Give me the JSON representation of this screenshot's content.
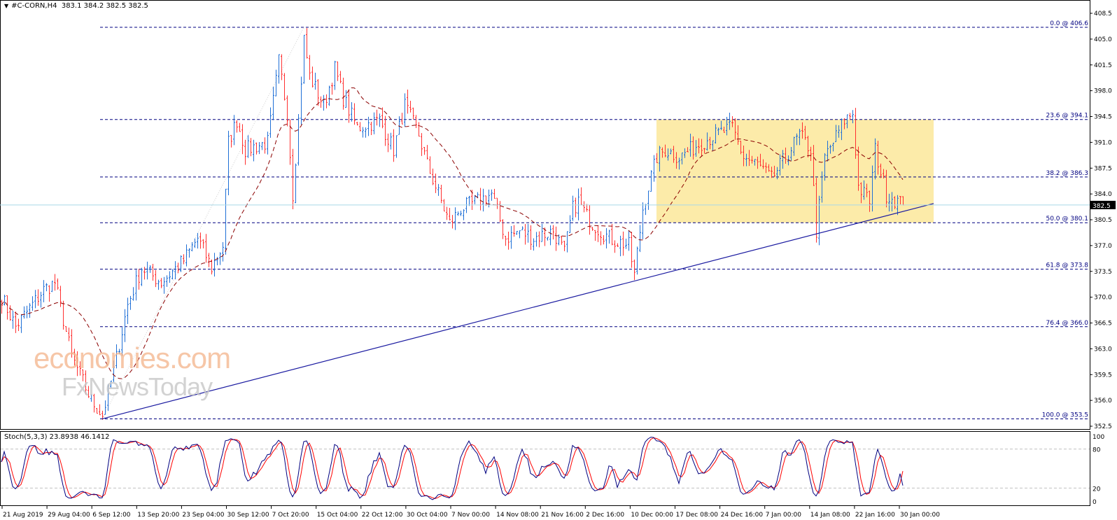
{
  "header": {
    "symbol": "#C-CORN,H4",
    "ohlc": "383.1 384.2 382.5 382.5"
  },
  "watermark": {
    "line1": "economies.com",
    "line2": "FxNewsToday"
  },
  "indicator": {
    "label": "Stoch(5,3,3) 23.8938 46.1412"
  },
  "colors": {
    "bull": "#1f6fd6",
    "bear": "#ff3030",
    "fib": "#000080",
    "trend": "#1a1aa0",
    "zone": "#fce89a",
    "ma": "#8b0000",
    "bid": "#a8d8e8",
    "stoch_main": "#000080",
    "stoch_signal": "#ff0000"
  },
  "chart_data": {
    "type": "ohlc",
    "title": "#C-CORN,H4",
    "ylim": [
      352.5,
      408.5
    ],
    "yticks": [
      "408.5",
      "405.0",
      "401.5",
      "398.0",
      "394.5",
      "391.0",
      "387.5",
      "384.0",
      "380.5",
      "377.0",
      "373.5",
      "370.0",
      "366.5",
      "363.0",
      "359.5",
      "356.0",
      "352.5"
    ],
    "current_price": "382.5",
    "xticks": [
      "21 Aug 2019",
      "29 Aug 04:00",
      "6 Sep 12:00",
      "13 Sep 20:00",
      "23 Sep 04:00",
      "30 Sep 12:00",
      "7 Oct 20:00",
      "15 Oct 04:00",
      "22 Oct 12:00",
      "30 Oct 04:00",
      "7 Nov 00:00",
      "14 Nov 08:00",
      "21 Nov 16:00",
      "2 Dec 16:00",
      "10 Dec 00:00",
      "17 Dec 08:00",
      "24 Dec 16:00",
      "7 Jan 00:00",
      "14 Jan 08:00",
      "22 Jan 16:00",
      "30 Jan 00:00"
    ],
    "price_path": [
      [
        0,
        370
      ],
      [
        5,
        366
      ],
      [
        15,
        371
      ],
      [
        19,
        372
      ],
      [
        25,
        362
      ],
      [
        32,
        356
      ],
      [
        36,
        354
      ],
      [
        40,
        360
      ],
      [
        45,
        369
      ],
      [
        50,
        374
      ],
      [
        57,
        372
      ],
      [
        65,
        375
      ],
      [
        70,
        378
      ],
      [
        75,
        374
      ],
      [
        79,
        377
      ],
      [
        81,
        391
      ],
      [
        84,
        394
      ],
      [
        87,
        390
      ],
      [
        95,
        391
      ],
      [
        99,
        402
      ],
      [
        102,
        395
      ],
      [
        104,
        384
      ],
      [
        106,
        394
      ],
      [
        108,
        405
      ],
      [
        110,
        400
      ],
      [
        115,
        396
      ],
      [
        119,
        401
      ],
      [
        122,
        397
      ],
      [
        127,
        393
      ],
      [
        135,
        394
      ],
      [
        140,
        390
      ],
      [
        144,
        396
      ],
      [
        149,
        392
      ],
      [
        152,
        388
      ],
      [
        157,
        383
      ],
      [
        160,
        380
      ],
      [
        164,
        382
      ],
      [
        170,
        383
      ],
      [
        175,
        384
      ],
      [
        180,
        378
      ],
      [
        185,
        379
      ],
      [
        190,
        378
      ],
      [
        197,
        379
      ],
      [
        201,
        376
      ],
      [
        204,
        382
      ],
      [
        206,
        383
      ],
      [
        209,
        381
      ],
      [
        211,
        380
      ],
      [
        217,
        378
      ],
      [
        224,
        377
      ],
      [
        226,
        373
      ],
      [
        229,
        382
      ],
      [
        231,
        385
      ],
      [
        234,
        389
      ],
      [
        237,
        390
      ],
      [
        242,
        389
      ],
      [
        250,
        391
      ],
      [
        255,
        392
      ],
      [
        261,
        393
      ],
      [
        265,
        389
      ],
      [
        270,
        388
      ],
      [
        275,
        386
      ],
      [
        280,
        389
      ],
      [
        285,
        392
      ],
      [
        289,
        390
      ],
      [
        291,
        379
      ],
      [
        294,
        389
      ],
      [
        297,
        391
      ],
      [
        301,
        394
      ],
      [
        304,
        395
      ],
      [
        306,
        385
      ],
      [
        310,
        383
      ],
      [
        312,
        390
      ],
      [
        316,
        384
      ],
      [
        320,
        383
      ],
      [
        322,
        382.5
      ]
    ],
    "fibonacci": [
      {
        "label": "0.0 @ 406.6",
        "price": 406.6
      },
      {
        "label": "23.6 @ 394.1",
        "price": 394.1
      },
      {
        "label": "38.2 @ 386.3",
        "price": 386.3
      },
      {
        "label": "50.0 @ 380.1",
        "price": 380.1
      },
      {
        "label": "61.8 @ 373.8",
        "price": 373.8
      },
      {
        "label": "76.4 @ 366.0",
        "price": 366.0
      },
      {
        "label": "100.0 @ 353.5",
        "price": 353.5
      }
    ],
    "zone": {
      "price_top": 394.1,
      "price_bottom": 380.1,
      "bar_start": 234,
      "bar_end": 333
    },
    "trendline": {
      "bar_start": 36,
      "price_start": 353.5,
      "bar_end": 333,
      "price_end": 382.7
    },
    "stoch": {
      "levels": [
        "100",
        "80",
        "20",
        "0"
      ],
      "k": 23.8938,
      "d": 46.1412
    }
  }
}
